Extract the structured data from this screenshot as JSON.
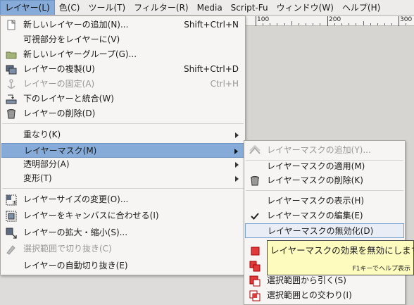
{
  "menubar": {
    "items": [
      {
        "label": "レイヤー(L)"
      },
      {
        "label": "色(C)"
      },
      {
        "label": "ツール(T)"
      },
      {
        "label": "フィルター(R)"
      },
      {
        "label": "Media"
      },
      {
        "label": "Script-Fu"
      },
      {
        "label": "ウィンドウ(W)"
      },
      {
        "label": "ヘルプ(H)"
      }
    ]
  },
  "ruler": {
    "labels": [
      "100",
      "200",
      "300"
    ]
  },
  "layer_menu": {
    "items": [
      {
        "label": "新しいレイヤーの追加(N)...",
        "shortcut": "Shift+Ctrl+N",
        "icon": "new-layer-icon",
        "enabled": true
      },
      {
        "label": "可視部分をレイヤーに(V)",
        "shortcut": "",
        "icon": "",
        "enabled": true
      },
      {
        "label": "新しいレイヤーグループ(G)...",
        "shortcut": "",
        "icon": "folder-icon",
        "enabled": true
      },
      {
        "label": "レイヤーの複製(U)",
        "shortcut": "Shift+Ctrl+D",
        "icon": "duplicate-layer-icon",
        "enabled": true
      },
      {
        "label": "レイヤーの固定(A)",
        "shortcut": "Ctrl+H",
        "icon": "anchor-icon",
        "enabled": false
      },
      {
        "label": "下のレイヤーと統合(W)",
        "shortcut": "",
        "icon": "merge-down-icon",
        "enabled": true
      },
      {
        "label": "レイヤーの削除(D)",
        "shortcut": "",
        "icon": "trash-icon",
        "enabled": true
      },
      {
        "label": "重なり(K)",
        "submenu": true
      },
      {
        "label": "レイヤーマスク(M)",
        "submenu": true,
        "active": true
      },
      {
        "label": "透明部分(A)",
        "submenu": true
      },
      {
        "label": "変形(T)",
        "submenu": true
      },
      {
        "label": "レイヤーサイズの変更(O)...",
        "icon": "layer-resize-icon",
        "enabled": true
      },
      {
        "label": "レイヤーをキャンバスに合わせる(I)",
        "icon": "layer-to-canvas-icon",
        "enabled": true
      },
      {
        "label": "レイヤーの拡大・縮小(S)...",
        "icon": "scale-layer-icon",
        "enabled": true
      },
      {
        "label": "選択範囲で切り抜き(C)",
        "icon": "crop-icon",
        "enabled": false
      },
      {
        "label": "レイヤーの自動切り抜き(E)",
        "icon": "",
        "enabled": true
      }
    ]
  },
  "mask_submenu": {
    "items": [
      {
        "label": "レイヤーマスクの追加(Y)...",
        "icon": "add-mask-icon",
        "enabled": false
      },
      {
        "label": "レイヤーマスクの適用(M)",
        "icon": "",
        "enabled": true
      },
      {
        "label": "レイヤーマスクの削除(K)",
        "icon": "trash-icon",
        "enabled": true
      },
      {
        "label": "レイヤーマスクの表示(H)",
        "icon": "",
        "enabled": true
      },
      {
        "label": "レイヤーマスクの編集(E)",
        "icon": "checkmark-icon",
        "enabled": true,
        "checked": true
      },
      {
        "label": "レイヤーマスクの無効化(D)",
        "icon": "",
        "enabled": true,
        "hovered": true
      },
      {
        "label": "選択範囲から引く(S)",
        "icon": "selection-subtract-icon",
        "enabled": true
      },
      {
        "label": "選択範囲との交わり(I)",
        "icon": "selection-intersect-icon",
        "enabled": true
      }
    ]
  },
  "tooltip": {
    "text": "レイヤーマスクの効果を無効にします",
    "help": "F1キーでヘルプ表示"
  },
  "colors": {
    "menu_highlight": "#86abd9",
    "tooltip_bg": "#fdfbbd",
    "mask_icon_red": "#e03a3a"
  }
}
